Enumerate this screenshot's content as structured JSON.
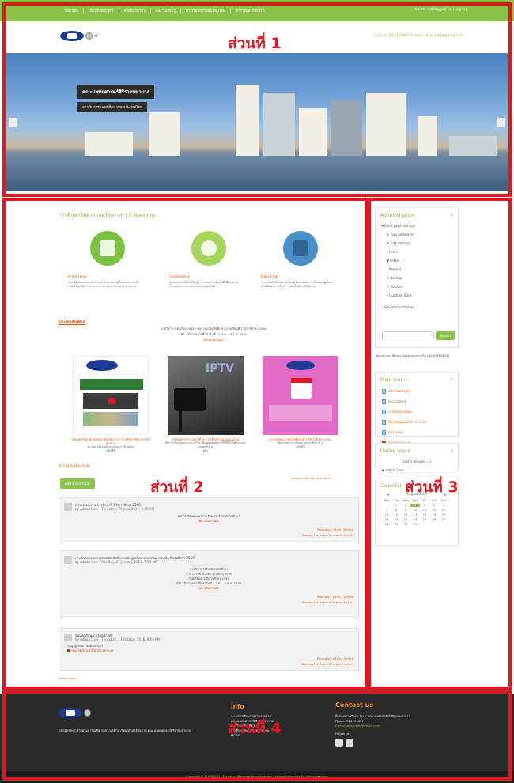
{
  "top_nav": {
    "links": [
      "หน้าหลัก",
      "เกี่ยวกับหลักสูตร",
      "คำอธิบายวิชา",
      "ผลงานเรียนรู้",
      "การเรียนการสอนออนไลน์",
      "ตารางและกิจกรรม"
    ],
    "login_status": "You are not logged in. (Log in)"
  },
  "brand": {
    "logo_text": "SI-HSE",
    "logo_sub": "E-learning",
    "contact_line": "Call us: 024194007  E-mail: sihse.edu@gmail.com"
  },
  "hero": {
    "title": "คณะแพทยศาสตร์ศิริราชพยาบาล",
    "subtitle": "สถาบันการแพทย์ชั้นนำของประเทศไทย",
    "prev": "‹",
    "next": "›"
  },
  "section_labels": {
    "s1": "ส่วนที่ 1",
    "s2": "ส่วนที่ 2",
    "s3": "ส่วนที่ 3",
    "s4": "ส่วนที่ 4"
  },
  "main": {
    "heading": "การศึกษาวิทยาศาสตร์สุขภาพ | E-learning",
    "features": [
      {
        "title": "E-learning",
        "desc": "เรียนรู้ด้วยตนเองผ่านระบบ E-learning ผู้เรียนสามารถเข้าเรียนได้ทุกที่ทุกเวลาตามความสะดวก ผ่านทาง internet"
      },
      {
        "title": "Community",
        "desc": "ชุมชนแลกเปลี่ยนเรียนรู้ระหว่างอาจารย์และนักศึกษาผ่านเว็บบอร์ดและกระดานสนทนาออนไลน์"
      },
      {
        "title": "Data Logs",
        "desc": "ระบบบันทึกข้อมูลการเรียนรู้ ติดตามผลการเรียนของผู้เรียน เพื่อพัฒนาการเรียนการสอนให้มีประสิทธิภาพ"
      }
    ],
    "pr_title": "ประชาสัมพันธ์",
    "pr_lines": [
      "ภาควิชาการจัดเก็บภาษาอังกฤษระดับบัณฑิตศึกษา ภาคเรียนที่ 1 ปีการศึกษา 2560",
      "เปิด - ปิดภาคการศึกษาวันที่ 13 ส.ค. - 9 ธ.ค. 2560"
    ],
    "pr_link": "คลิกเพื่ออ่านต่อ",
    "cards": [
      {
        "title": "หลักสูตรวิทยาศาสตรมหาบัณฑิต สาขาการศึกษาวิทยาศาสตร์สุขภาพ",
        "desc": "ดูรายละเอียดหลักสูตรและการรับสมัคร",
        "link": "คลิกที่นี่"
      },
      {
        "title": "หลักสูตร IPTV และวิดีโอ การเรียนการสอนออนไลน์",
        "desc": "สื่อการเรียนรู้ผ่านระบบ IPTV เพื่อเผยแพร่ความรู้ให้กับนักศึกษาและบุคคลทั่วไป",
        "link": "คลิก"
      },
      {
        "title": "ตารางสอน ภาคการศึกษาที่ 1 ปีการศึกษา 2560",
        "desc": "ติดตามตารางเรียนภาคการศึกษาที่ 1",
        "link": "คลิกที่นี่"
      }
    ],
    "news_title": "ข่าวและประกาศ",
    "add_topic": "Add a new topic",
    "subscribe": "Unsubscribe from this forum",
    "posts": [
      {
        "title": "ตารางสอน ภาคการศึกษาที่ 1 ปีการศึกษา 2560",
        "by": "by Admin User - Thursday, 29 June 2017, 9:00 AM",
        "body": [
          "ผลการเรียนและตารางเรียนประจำภาคการศึกษา"
        ],
        "link": "คลิกเพื่ออ่านต่อ",
        "actions": "Permalink | Edit | Delete",
        "discuss": "Discuss this topic (0 replies so far)"
      },
      {
        "title": "ภาควิชาการจัดการรับสมัครนักศึกษาหลักสูตรวิทยาศาสตรมหาบัณฑิต ปีการศึกษา 2559",
        "by": "by Admin User - Monday, 23 January 2017, 7:54 AM",
        "body": [
          "ภาควิชาการรับสมัครนักศึกษา",
          "สาขาการศึกษาวิทยาศาสตร์สุขภาพ",
          "ภาคเรียนที่ 1 ปีการศึกษา 2559",
          "เปิด - ปิดภาคการศึกษาวันที่ 7 ส.ค. - 9 ธ.ค. 2560"
        ],
        "link": "คลิกเพื่ออ่านต่อ",
        "actions": "Permalink | Edit | Delete",
        "discuss": "Discuss this topic (0 replies so far)"
      },
      {
        "title": "ข้อมูลผู้เรียนภายใต้หลักสูตร",
        "by": "by Admin User - Thursday, 13 October 2016, 9:00 PM",
        "body": [
          "ข้อมูลผู้เรียนภายใต้หลักสูตร"
        ],
        "link": "ข้อมูลผู้เรียนภายใต้หลักสูตร pdf",
        "actions": "Permalink | Edit | Delete",
        "discuss": "Discuss this topic (0 replies so far)"
      }
    ],
    "older": "Older topics ..."
  },
  "sidebar": {
    "admin_title": "Administration",
    "admin_items": [
      "Front page settings",
      "Turn editing on",
      "Edit settings",
      "Users",
      "Filters",
      "Reports",
      "Backup",
      "Restore",
      "Question bank",
      "Site administration"
    ],
    "search_btn": "Search",
    "note": "ผู้ดูแลระบบ: ผู้ติดต่อ ติดต่อผู้ดูแลระบบได้ Call 024194007",
    "menu_title": "Main menu",
    "menu_items": [
      "เกี่ยวกับหลักสูตร",
      "ผลงานเรียนรู้",
      "การเรียนการสอน",
      "ห้องเรียนออนไลน์ - Course",
      "ตารางสอน",
      "ข่าวและประกาศ"
    ],
    "online_title": "Online users",
    "online_text": "(last 5 minutes: 1)",
    "online_user": "Admin User",
    "cal_title": "Calendar",
    "cal_month": "August 2017",
    "cal_days": [
      "Mon",
      "Tue",
      "Wed",
      "Thu",
      "Fri",
      "Sat",
      "Sun"
    ],
    "cal_dates": [
      "",
      "1",
      "2",
      "3",
      "4",
      "5",
      "6",
      "7",
      "8",
      "9",
      "10",
      "11",
      "12",
      "13",
      "14",
      "15",
      "16",
      "17",
      "18",
      "19",
      "20",
      "21",
      "22",
      "23",
      "24",
      "25",
      "26",
      "27",
      "28",
      "29",
      "30",
      "31"
    ]
  },
  "footer": {
    "tagline": "หลักสูตรวิทยาศาสตรมหาบัณฑิต สาขาการศึกษาวิทยาศาสตร์สุขภาพ คณะแพทยศาสตร์ศิริราชพยาบาล",
    "info_title": "Info",
    "info_lines": [
      "ระบบการเรียนการสอนออนไลน์",
      "คณะแพทยศาสตร์ศิริราชพยาบาล",
      "มหาวิทยาลัยมหิดล",
      "การศึกษาวิทยาศาสตร์สุขภาพ",
      "MORE"
    ],
    "contact_title": "Contact us",
    "contact_lines": [
      "ตึกอดุลยเดชวิกรม ชั้น 2 คณะแพทยศาสตร์ศิริราชพยาบาล",
      "Phone: 024194007",
      "E-mail: sihse.edu@gmail.com"
    ],
    "follow": "Follow us",
    "copyright": "Copyright © SI-HSE 2017 Faculty of Medicine Siriraj Hospital, Mahidol University. All rights reserved."
  },
  "colors": {
    "frame": "#e8141d",
    "green": "#8bc34a",
    "orange": "#e65100",
    "footer_bg": "#2a2a2a"
  }
}
